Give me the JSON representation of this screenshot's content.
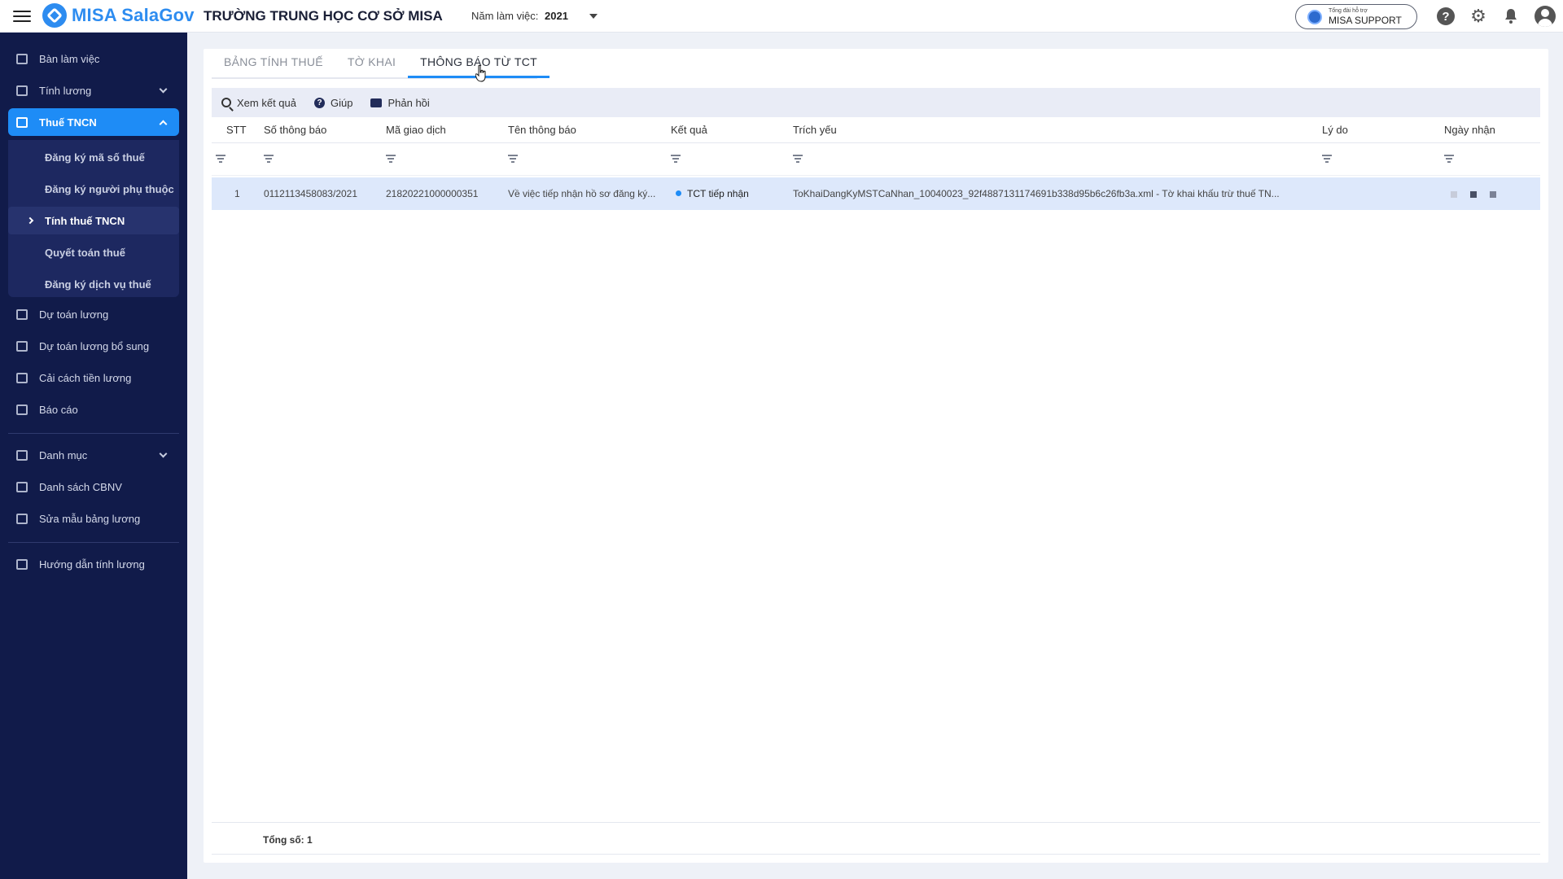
{
  "app": {
    "brand": "MISA SalaGov",
    "organization": "TRƯỜNG TRUNG HỌC CƠ SỞ MISA",
    "year_label": "Năm làm việc:",
    "year_value": "2021",
    "support_small": "Tổng đài hỗ trợ",
    "support_big": "MISA SUPPORT",
    "icons": [
      "menu-icon",
      "help-icon",
      "gear-icon",
      "bell-icon",
      "user-avatar-icon"
    ]
  },
  "sidebar": {
    "items": [
      {
        "label": "Bàn làm việc",
        "icon": "dashboard-icon"
      },
      {
        "label": "Tính lương",
        "icon": "payroll-icon"
      },
      {
        "label": "Thuế TNCN",
        "icon": "tax-icon"
      },
      {
        "label": "Dự toán lương",
        "icon": "estimate-icon"
      },
      {
        "label": "Dự toán lương bổ sung",
        "icon": "estimate-extra-icon"
      },
      {
        "label": "Cải cách tiền lương",
        "icon": "reform-icon"
      },
      {
        "label": "Báo cáo",
        "icon": "report-icon"
      },
      {
        "label": "Danh mục",
        "icon": "list-icon"
      },
      {
        "label": "Danh sách CBNV",
        "icon": "staff-icon"
      },
      {
        "label": "Sửa mẫu bảng lương",
        "icon": "template-icon"
      },
      {
        "label": "Hướng dẫn tính lương",
        "icon": "guide-icon"
      }
    ],
    "subitems": [
      {
        "label": "Đăng ký mã số thuế"
      },
      {
        "label": "Đăng ký người phụ thuộc"
      },
      {
        "label": "Tính thuế TNCN"
      },
      {
        "label": "Quyết toán thuế"
      },
      {
        "label": "Đăng ký dịch vụ thuế"
      }
    ]
  },
  "tabs": [
    {
      "label": "BẢNG TÍNH THUẾ"
    },
    {
      "label": "TỜ KHAI"
    },
    {
      "label": "THÔNG BÁO TỪ TCT"
    }
  ],
  "toolbar": {
    "view_results": "Xem kết quả",
    "help": "Giúp",
    "feedback": "Phản hồi"
  },
  "table": {
    "columns": [
      "STT",
      "Số thông báo",
      "Mã giao dịch",
      "Tên thông báo",
      "Kết quả",
      "Trích yếu",
      "Lý do",
      "Ngày nhận"
    ],
    "rows": [
      {
        "stt": "1",
        "so_thong_bao": "0112113458083/2021",
        "ma_giao_dich": "21820221000000351",
        "ten_thong_bao": "Về việc tiếp nhận hồ sơ đăng ký...",
        "ket_qua": "TCT tiếp nhận",
        "trich_yeu": "ToKhaiDangKyMSTCaNhan_10040023_92f4887131174691b338d95b6c26fb3a.xml - Tờ khai khấu trừ thuế TN...",
        "ly_do": "",
        "ngay_nhan": ""
      }
    ],
    "total_label": "Tổng số: 1"
  },
  "colors": {
    "accent": "#1e8cf6",
    "sidebar_bg": "#111b4a",
    "row_selected": "#dde8fb"
  }
}
